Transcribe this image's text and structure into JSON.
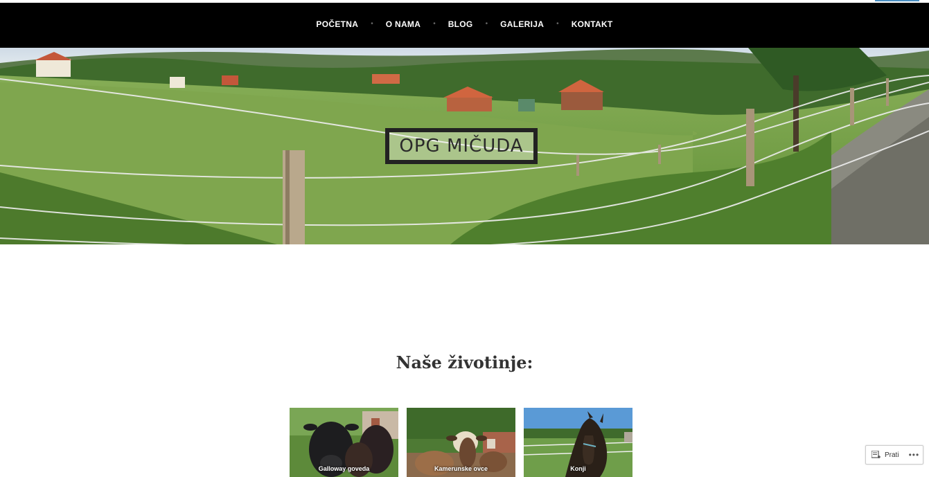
{
  "nav": {
    "items": [
      {
        "label": "POČETNA"
      },
      {
        "label": "O NAMA"
      },
      {
        "label": "BLOG"
      },
      {
        "label": "GALERIJA"
      },
      {
        "label": "KONTAKT"
      }
    ],
    "separator": "•"
  },
  "hero": {
    "site_title": "OPG MIČUDA"
  },
  "main": {
    "section_title": "Naše životinje:",
    "animals": [
      {
        "caption": "Galloway goveda"
      },
      {
        "caption": "Kamerunske ovce"
      },
      {
        "caption": "Konji"
      }
    ]
  },
  "follow_button": {
    "label": "Prati",
    "more": "•••"
  },
  "colors": {
    "navbar": "#000000",
    "accent": "#4a8fc2"
  }
}
